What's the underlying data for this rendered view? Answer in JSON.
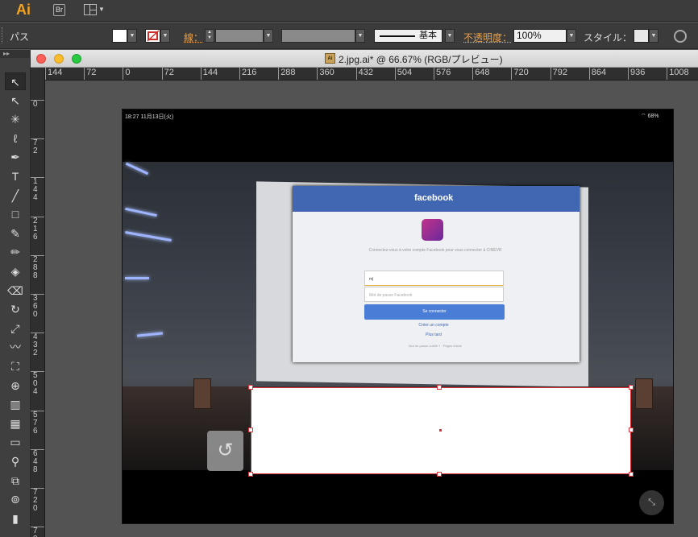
{
  "app": {
    "logo": "Ai",
    "bridge_label": "Br"
  },
  "controlbar": {
    "path_label": "パス",
    "stroke_label": "線：",
    "stroke_profile_label": "基本",
    "opacity_label": "不透明度：",
    "opacity_value": "100%",
    "style_label": "スタイル："
  },
  "toolbar": {
    "header": "▸▸",
    "tools": [
      {
        "name": "selection-tool",
        "glyph": "↖"
      },
      {
        "name": "direct-selection-tool",
        "glyph": "↖"
      },
      {
        "name": "magic-wand-tool",
        "glyph": "✳"
      },
      {
        "name": "lasso-tool",
        "glyph": "ℓ"
      },
      {
        "name": "pen-tool",
        "glyph": "✒"
      },
      {
        "name": "type-tool",
        "glyph": "T"
      },
      {
        "name": "line-tool",
        "glyph": "╱"
      },
      {
        "name": "rectangle-tool",
        "glyph": "□"
      },
      {
        "name": "paintbrush-tool",
        "glyph": "✎"
      },
      {
        "name": "pencil-tool",
        "glyph": "✏"
      },
      {
        "name": "shaper-tool",
        "glyph": "◈"
      },
      {
        "name": "eraser-tool",
        "glyph": "⌫"
      },
      {
        "name": "rotate-tool",
        "glyph": "↻"
      },
      {
        "name": "scale-tool",
        "glyph": "⤢"
      },
      {
        "name": "warp-tool",
        "glyph": "〰"
      },
      {
        "name": "free-transform-tool",
        "glyph": "⛶"
      },
      {
        "name": "shape-builder-tool",
        "glyph": "⊕"
      },
      {
        "name": "graph-tool",
        "glyph": "▥"
      },
      {
        "name": "mesh-tool",
        "glyph": "▦"
      },
      {
        "name": "gradient-tool",
        "glyph": "▭"
      },
      {
        "name": "eyedropper-tool",
        "glyph": "⚲"
      },
      {
        "name": "blend-tool",
        "glyph": "⧉"
      },
      {
        "name": "symbol-sprayer-tool",
        "glyph": "⊚"
      },
      {
        "name": "column-graph-tool",
        "glyph": "▮"
      }
    ]
  },
  "document": {
    "title": "2.jpg.ai* @ 66.67% (RGB/プレビュー)",
    "file_icon_label": "Ai",
    "hruler": [
      "144",
      "72",
      "0",
      "72",
      "144",
      "216",
      "288",
      "360",
      "432",
      "504",
      "576",
      "648",
      "720",
      "792",
      "864",
      "936",
      "1008"
    ],
    "vruler": [
      "0",
      "72",
      "144",
      "216",
      "288",
      "360",
      "432",
      "504",
      "576",
      "648",
      "720",
      "792"
    ]
  },
  "artboard": {
    "status_time": "18:27  11月13日(火)",
    "status_battery": "⌔ 68%",
    "facebook": {
      "title": "facebook",
      "prompt": "Connectez-vous à votre compte Facebook pour vous connecter à CINEVR",
      "email_value": "m|",
      "password_placeholder": "Mot de passe Facebook",
      "login_button": "Se connecter",
      "create_account": "Créer un compte",
      "later": "Plus tard",
      "footer": "Mot de passe oublié ? · Pages d'aide"
    },
    "back_glyph": "↺",
    "collapse_glyph": "⤡"
  },
  "colors": {
    "selection": "#e0303a",
    "facebook_blue": "#4267b2",
    "ai_orange": "#f4a31b"
  }
}
